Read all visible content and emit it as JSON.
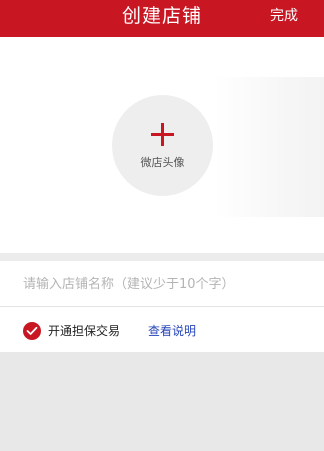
{
  "header": {
    "title": "创建店铺",
    "done_label": "完成"
  },
  "avatar": {
    "icon": "plus-icon",
    "label": "微店头像"
  },
  "shop_name": {
    "value": "",
    "placeholder": "请输入店铺名称（建议少于10个字）"
  },
  "guarantee": {
    "checked": true,
    "label": "开通担保交易",
    "link_label": "查看说明"
  },
  "colors": {
    "brand": "#c81623",
    "link": "#2745b8"
  }
}
